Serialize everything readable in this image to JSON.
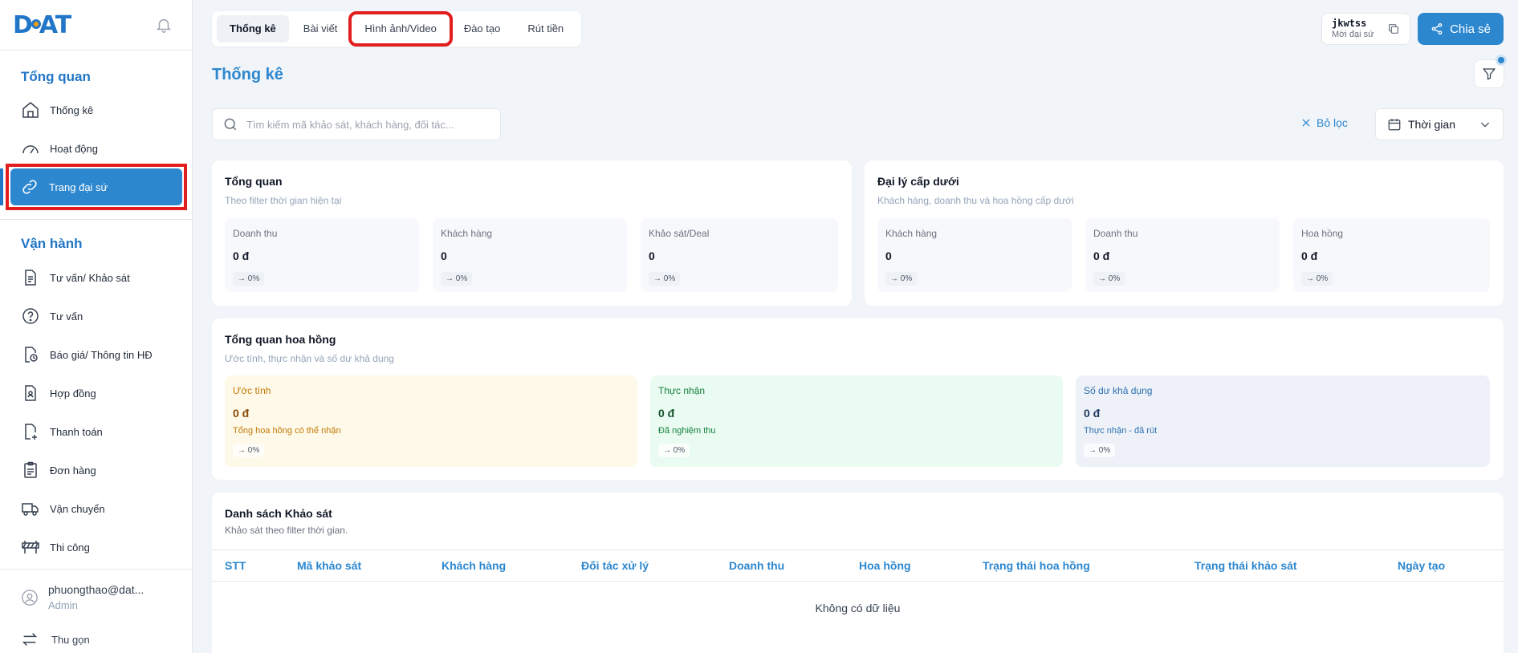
{
  "sidebar": {
    "logo": "DAT",
    "section_overview": "Tổng quan",
    "overview_items": [
      {
        "label": "Thống kê"
      },
      {
        "label": "Hoạt động"
      },
      {
        "label": "Trang đại sứ"
      }
    ],
    "section_operations": "Vận hành",
    "operation_items": [
      {
        "label": "Tư vấn/ Khảo sát"
      },
      {
        "label": "Tư vấn"
      },
      {
        "label": "Báo giá/ Thông tin HĐ"
      },
      {
        "label": "Hợp đồng"
      },
      {
        "label": "Thanh toán"
      },
      {
        "label": "Đơn hàng"
      },
      {
        "label": "Vận chuyển"
      },
      {
        "label": "Thi công"
      }
    ],
    "user_name": "phuongthao@dat...",
    "user_role": "Admin",
    "collapse_label": "Thu gọn"
  },
  "tabs": [
    {
      "label": "Thống kê"
    },
    {
      "label": "Bài viết"
    },
    {
      "label": "Hình ảnh/Video"
    },
    {
      "label": "Đào tạo"
    },
    {
      "label": "Rút tiền"
    }
  ],
  "referral": {
    "code": "jkwtss",
    "label": "Mời đại sứ"
  },
  "share_label": "Chia sẻ",
  "page_title": "Thống kê",
  "search": {
    "placeholder": "Tìm kiếm mã khảo sát, khách hàng, đối tác..."
  },
  "clear_filter_label": "Bỏ lọc",
  "time_select_label": "Thời gian",
  "overview_card": {
    "title": "Tổng quan",
    "subtitle": "Theo filter thời gian hiện tại",
    "stats": [
      {
        "label": "Doanh thu",
        "value": "0 đ",
        "trend": "→ 0%"
      },
      {
        "label": "Khách hàng",
        "value": "0",
        "trend": "→ 0%"
      },
      {
        "label": "Khảo sát/Deal",
        "value": "0",
        "trend": "→ 0%"
      }
    ]
  },
  "agent_card": {
    "title": "Đại lý cấp dưới",
    "subtitle": "Khách hàng, doanh thu và hoa hồng cấp dưới",
    "stats": [
      {
        "label": "Khách hàng",
        "value": "0",
        "trend": "→ 0%"
      },
      {
        "label": "Doanh thu",
        "value": "0 đ",
        "trend": "→ 0%"
      },
      {
        "label": "Hoa hồng",
        "value": "0 đ",
        "trend": "→ 0%"
      }
    ]
  },
  "commission_card": {
    "title": "Tổng quan hoa hồng",
    "subtitle": "Ước tính, thực nhận và số dư khả dụng",
    "stats": [
      {
        "label": "Ước tính",
        "value": "0 đ",
        "desc": "Tổng hoa hồng có thể nhận",
        "trend": "→ 0%"
      },
      {
        "label": "Thực nhận",
        "value": "0 đ",
        "desc": "Đã nghiệm thu",
        "trend": "→ 0%"
      },
      {
        "label": "Số dư khả dụng",
        "value": "0 đ",
        "desc": "Thực nhận - đã rút",
        "trend": "→ 0%"
      }
    ]
  },
  "survey_table": {
    "title": "Danh sách Khảo sát",
    "subtitle": "Khảo sát theo filter thời gian.",
    "columns": [
      "STT",
      "Mã khảo sát",
      "Khách hàng",
      "Đối tác xử lý",
      "Doanh thu",
      "Hoa hồng",
      "Trạng thái hoa hồng",
      "Trạng thái khảo sát",
      "Ngày tạo"
    ],
    "empty_text": "Không có dữ liệu"
  },
  "colors": {
    "accent": "#2c87cf",
    "highlight": "#e21d1d"
  }
}
